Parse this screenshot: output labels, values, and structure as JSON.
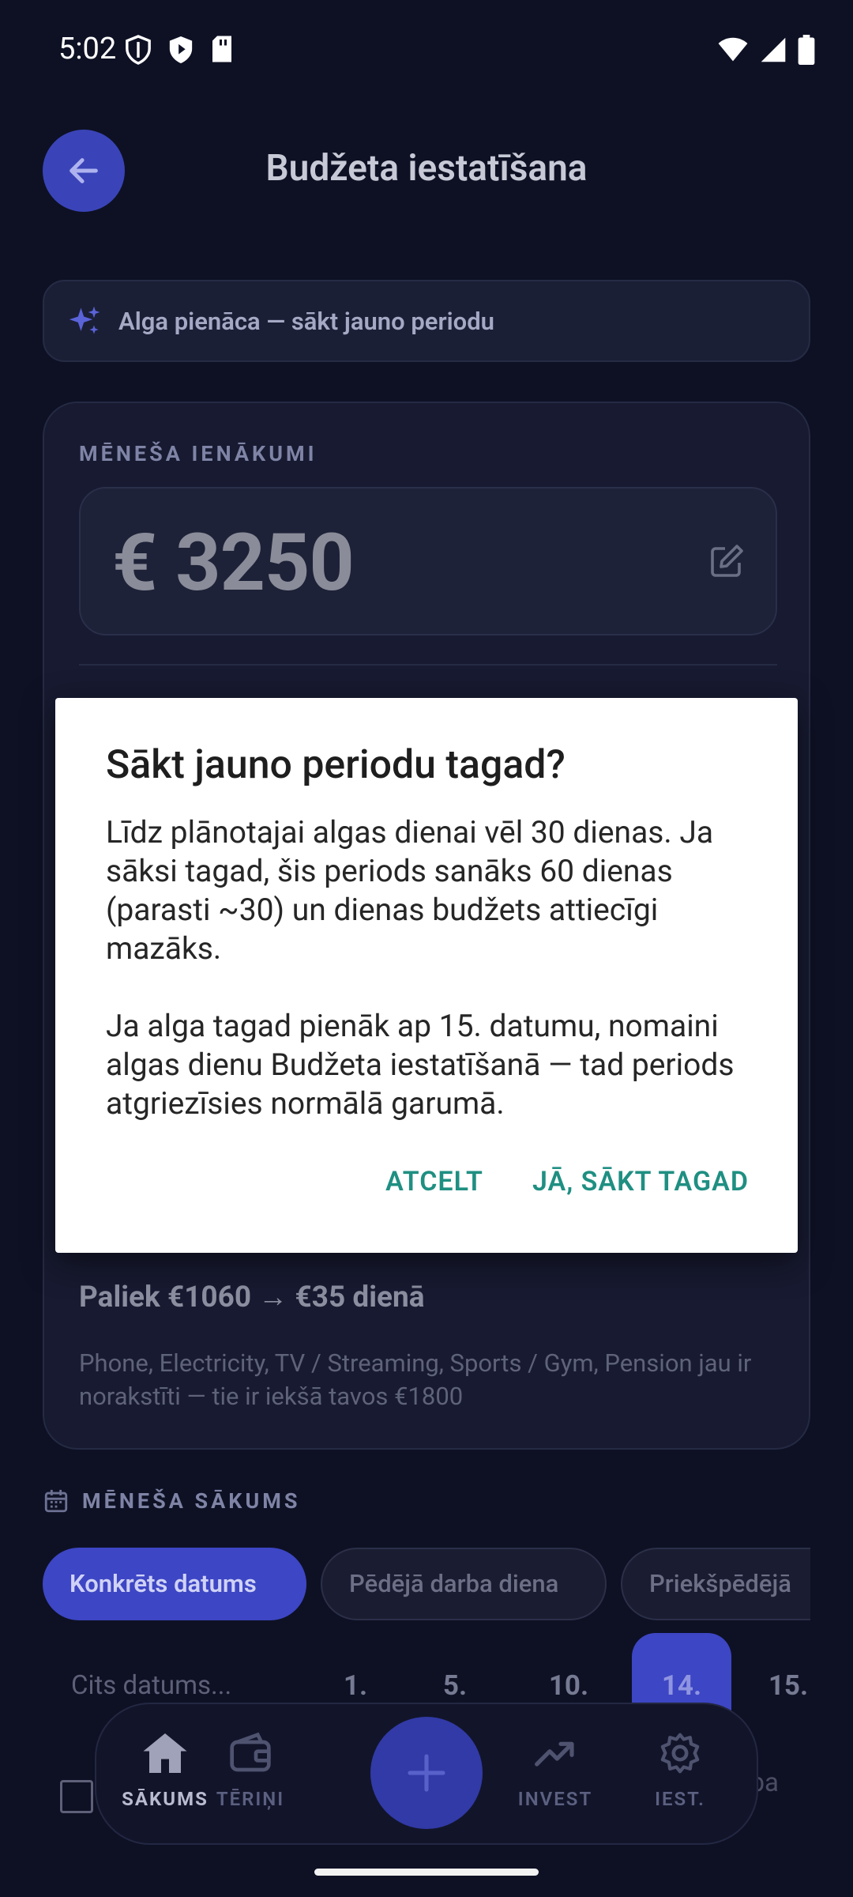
{
  "status_bar": {
    "time": "5:02"
  },
  "header": {
    "title": "Budžeta iestatīšana"
  },
  "banner": {
    "text": "Alga pienāca — sākt jauno periodu"
  },
  "income": {
    "section_label": "MĒNEŠA IENĀKUMI",
    "value": "€ 3250",
    "remaining": "Paliek €1060 → €35 dienā",
    "note": "Phone, Electricity, TV / Streaming, Sports / Gym, Pension jau ir norakstīti — tie ir iekšā tavos €1800"
  },
  "month_start": {
    "section_label": "MĒNEŠA SĀKUMS",
    "chips": [
      "Konkrēts datums",
      "Pēdējā darba diena",
      "Priekšpēdējā"
    ],
    "other_date": "Cits datums...",
    "dates": [
      "1.",
      "5.",
      "10.",
      "14.",
      "15."
    ],
    "selected_date": "14.",
    "row_tail": "ba"
  },
  "nav": {
    "home": "SĀKUMS",
    "expenses": "TĒRIŅI",
    "invest": "INVEST",
    "settings": "IEST."
  },
  "dialog": {
    "title": "Sākt jauno periodu tagad?",
    "paragraph1": "Līdz plānotajai algas dienai vēl 30 dienas. Ja sāksi tagad, šis periods sanāks 60 dienas (parasti ~30) un dienas budžets attiecīgi mazāks.",
    "paragraph2": "Ja alga tagad pienāk ap 15. datumu, nomaini algas dienu Budžeta iestatīšanā — tad periods atgriezīsies normālā garumā.",
    "cancel": "ATCELT",
    "confirm": "JĀ, SĀKT TAGAD"
  },
  "colors": {
    "background": "#0e1124",
    "accent": "#3d46c4",
    "dialog_button": "#1f8f82"
  }
}
